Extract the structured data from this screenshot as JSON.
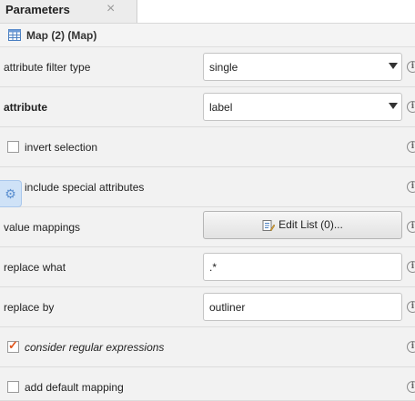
{
  "tab": {
    "title": "Parameters",
    "close_glyph": "×"
  },
  "operator": {
    "title": "Map (2) (Map)",
    "icon": "map-table-icon"
  },
  "rows": {
    "attribute_filter_type": {
      "label": "attribute filter type",
      "value": "single"
    },
    "attribute": {
      "label": "attribute",
      "value": "label"
    },
    "invert_selection": {
      "label": "invert selection",
      "checked": false
    },
    "include_special_attributes": {
      "label": "include special attributes",
      "checked": true
    },
    "value_mappings": {
      "label": "value mappings",
      "button": "Edit List (0)..."
    },
    "replace_what": {
      "label": "replace what",
      "value": ".*"
    },
    "replace_by": {
      "label": "replace by",
      "value": "outliner"
    },
    "consider_regular_expressions": {
      "label": "consider regular expressions",
      "checked": true
    },
    "add_default_mapping": {
      "label": "add default mapping",
      "checked": false
    }
  },
  "colors": {
    "accent_check": "#e0561d",
    "row_bg": "#f2f2f2"
  }
}
